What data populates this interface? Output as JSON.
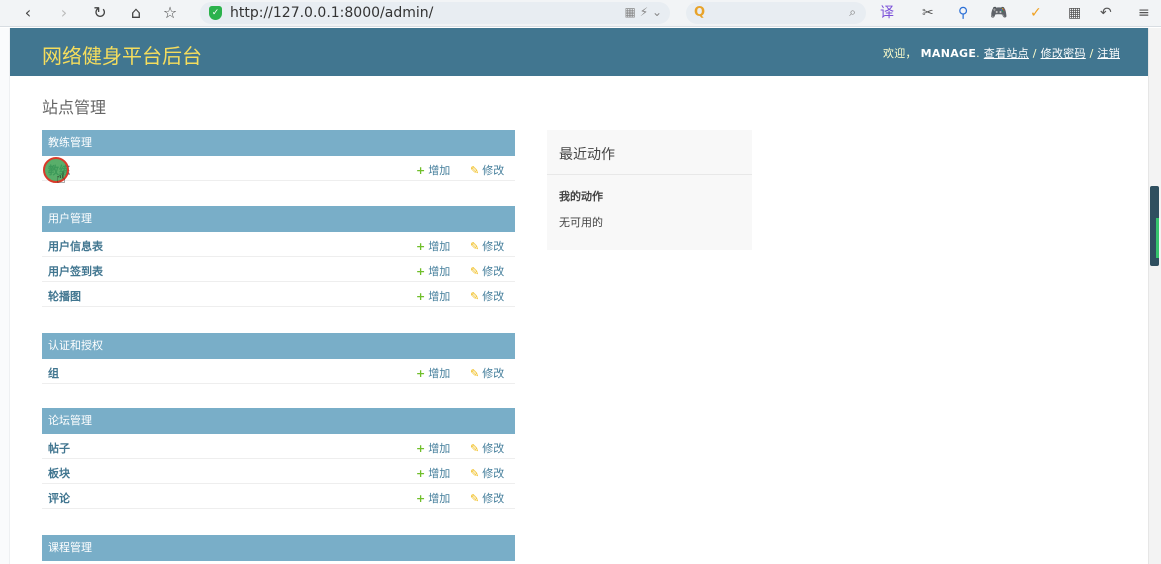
{
  "browser": {
    "back": "‹",
    "forward": "›",
    "reload": "↻",
    "home": "⌂",
    "star": "☆",
    "url": "http://127.0.0.1:8000/admin/",
    "addr_tools": "▦ ⚡ ⌄",
    "search_logo": "Q",
    "search_icon": "⌕",
    "extensions": [
      "译",
      "✂",
      "⚲",
      "🎮",
      "✓",
      "▦",
      "↶",
      "≡"
    ]
  },
  "header": {
    "brand": "网络健身平台后台",
    "welcome": "欢迎，",
    "username": "MANAGE",
    "view_site": "查看站点",
    "sep1": " / ",
    "change_password": "修改密码",
    "sep2": " / ",
    "logout": "注销"
  },
  "page_title": "站点管理",
  "modules": [
    {
      "caption": "教练管理",
      "models": [
        {
          "name": "教练"
        }
      ]
    },
    {
      "caption": "用户管理",
      "models": [
        {
          "name": "用户信息表"
        },
        {
          "name": "用户签到表"
        },
        {
          "name": "轮播图"
        }
      ]
    },
    {
      "caption": "认证和授权",
      "models": [
        {
          "name": "组"
        }
      ]
    },
    {
      "caption": "论坛管理",
      "models": [
        {
          "name": "帖子"
        },
        {
          "name": "板块"
        },
        {
          "name": "评论"
        }
      ]
    },
    {
      "caption": "课程管理",
      "models": []
    }
  ],
  "add_label": "增加",
  "change_label": "修改",
  "recent": {
    "title": "最近动作",
    "my_actions": "我的动作",
    "none": "无可用的"
  },
  "colors": {
    "header_bg": "#417690",
    "brand": "#f5dd5d",
    "caption_bg": "#79aec8",
    "link": "#447e9b"
  }
}
